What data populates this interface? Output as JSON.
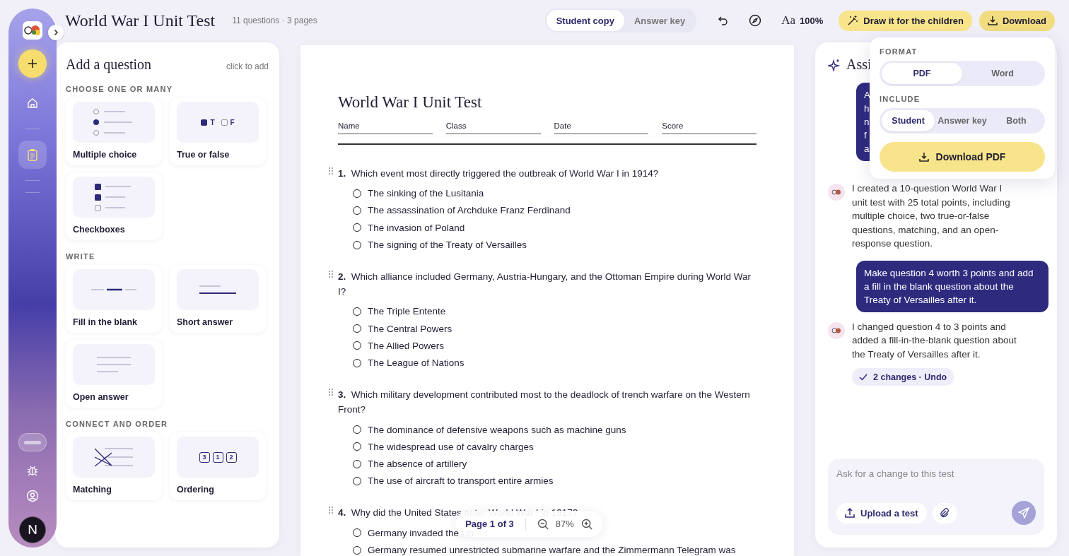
{
  "rail": {
    "nav": [
      {
        "kind": "home",
        "selected": false
      },
      {
        "kind": "tests",
        "selected": true
      }
    ],
    "toggle": {
      "on": false
    },
    "avatar": "N"
  },
  "header": {
    "title": "World War I Unit Test",
    "meta": "11 questions · 3 pages",
    "view_tabs": [
      {
        "label": "Student copy",
        "selected": true
      },
      {
        "label": "Answer key",
        "selected": false
      }
    ],
    "text_size_label": "Aa",
    "text_size": "100%",
    "draw_button": "Draw it for the children",
    "download_button": "Download"
  },
  "question_panel": {
    "title": "Add a question",
    "hint": "click to add",
    "groups": [
      {
        "heading": "CHOOSE ONE OR MANY",
        "types": [
          {
            "kind": "multiple",
            "label": "Multiple choice"
          },
          {
            "kind": "truefalse",
            "label": "True or false",
            "preview": [
              "T",
              "F"
            ]
          },
          {
            "kind": "checkboxes",
            "label": "Checkboxes"
          }
        ]
      },
      {
        "heading": "WRITE",
        "types": [
          {
            "kind": "blank",
            "label": "Fill in the blank"
          },
          {
            "kind": "short",
            "label": "Short answer"
          },
          {
            "kind": "open",
            "label": "Open answer"
          }
        ]
      },
      {
        "heading": "CONNECT AND ORDER",
        "types": [
          {
            "kind": "matching",
            "label": "Matching"
          },
          {
            "kind": "ordering",
            "label": "Ordering",
            "preview": [
              "3",
              "1",
              "2"
            ]
          }
        ]
      }
    ]
  },
  "paper": {
    "title": "World War I Unit Test",
    "fields": [
      "Name",
      "Class",
      "Date",
      "Score"
    ],
    "questions": [
      {
        "number": "1.",
        "text": "Which event most directly triggered the outbreak of World War I in 1914?",
        "options": [
          {
            "text": "The sinking of the Lusitania",
            "selected": false
          },
          {
            "text": "The assassination of Archduke Franz Ferdinand",
            "selected": false
          },
          {
            "text": "The invasion of Poland",
            "selected": false
          },
          {
            "text": "The signing of the Treaty of Versailles",
            "selected": false
          }
        ]
      },
      {
        "number": "2.",
        "text": "Which alliance included Germany, Austria-Hungary, and the Ottoman Empire during World War I?",
        "options": [
          {
            "text": "The Triple Entente",
            "selected": false
          },
          {
            "text": "The Central Powers",
            "selected": false
          },
          {
            "text": "The Allied Powers",
            "selected": false
          },
          {
            "text": "The League of Nations",
            "selected": false
          }
        ]
      },
      {
        "number": "3.",
        "text": "Which military development contributed most to the deadlock of trench warfare on the Western Front?",
        "options": [
          {
            "text": "The dominance of defensive weapons such as machine guns",
            "selected": false
          },
          {
            "text": "The widespread use of cavalry charges",
            "selected": false
          },
          {
            "text": "The absence of artillery",
            "selected": false
          },
          {
            "text": "The use of aircraft to transport entire armies",
            "selected": false
          }
        ]
      },
      {
        "number": "4.",
        "text": "Why did the United States enter World War I in 1917?",
        "options": [
          {
            "text": "Germany invaded the Un",
            "selected": false
          },
          {
            "text": "Germany resumed unrestricted submarine warfare and the Zimmermann Telegram was",
            "selected": false
          }
        ]
      }
    ]
  },
  "pager": {
    "page": "Page 1 of 3",
    "zoom": "87%"
  },
  "assistant": {
    "title": "Assi",
    "messages": [
      {
        "kind": "user",
        "lines": [
          "A",
          "h",
          "n",
          "f",
          "a"
        ]
      },
      {
        "kind": "assistant",
        "text": "I created a 10-question World War I unit test with 25 total points, including multiple choice, two true-or-false questions, matching, and an open-response question."
      },
      {
        "kind": "user",
        "text": "Make question 4 worth 3 points and add a fill in the blank question about the Treaty of Versailles after it."
      },
      {
        "kind": "assistant",
        "text": "I changed question 4 to 3 points and added a fill-in-the-blank question about the Treaty of Versailles after it.",
        "changes": "2 changes · Undo"
      }
    ],
    "input": {
      "placeholder": "Ask for a change to this test"
    },
    "upload_button": "Upload a test"
  },
  "download_menu": {
    "format_label": "FORMAT",
    "formats": [
      {
        "label": "PDF",
        "selected": true
      },
      {
        "label": "Word",
        "selected": false
      }
    ],
    "include_label": "INCLUDE",
    "include": [
      {
        "label": "Student",
        "selected": true
      },
      {
        "label": "Answer key",
        "selected": false
      },
      {
        "label": "Both",
        "selected": false
      }
    ],
    "button": "Download PDF"
  }
}
